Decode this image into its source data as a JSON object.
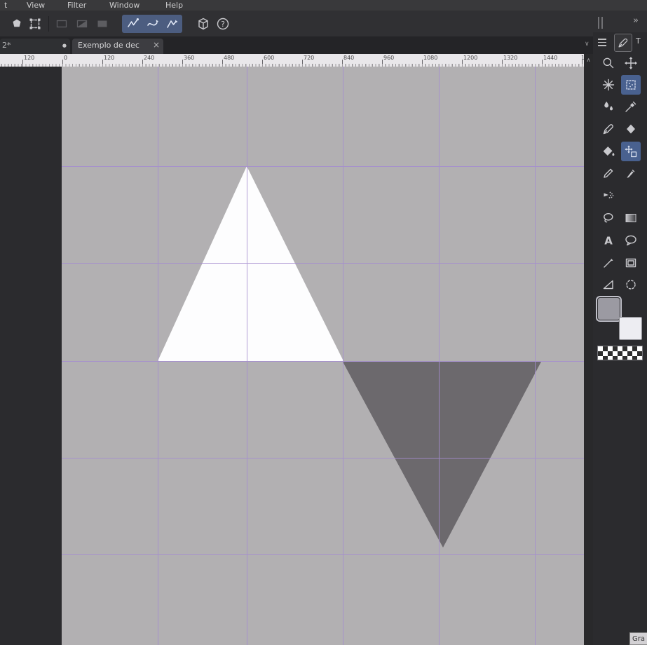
{
  "menu_bar": {
    "items": [
      "t",
      "View",
      "Filter",
      "Window",
      "Help"
    ]
  },
  "top_toolbar": {
    "tools": [
      "selection",
      "transform-frame",
      "marquee-rectangle",
      "marquee-shaded",
      "marquee-filled",
      "selection-polyline",
      "selection-curve",
      "selection-pen",
      "3d-cube",
      "help"
    ],
    "help_glyph": "?"
  },
  "window_chrome": {
    "collapse_glyph": "»",
    "scroll_up_glyph": "∧",
    "tab_list_glyph": "∨"
  },
  "tabs": {
    "partial": {
      "label": "2*",
      "modified_indicator": "●"
    },
    "active": {
      "label": "Exemplo de dec",
      "close_glyph": "×"
    }
  },
  "ruler": {
    "labels": [
      "120",
      "0",
      "120",
      "240",
      "360",
      "480",
      "600",
      "720",
      "840",
      "960",
      "1080",
      "1200",
      "1320",
      "1440",
      "1"
    ]
  },
  "canvas": {
    "background": "#b2b0b2",
    "pasteboard": "#2b2b2e",
    "grid_color": "#a58dd0",
    "triangle_up_fill": "#fdfdfe",
    "triangle_down_fill": "#6c696d"
  },
  "tool_palette": {
    "header_label": "T",
    "tools": [
      "zoom",
      "move",
      "operation",
      "auto-select",
      "blend",
      "eyedropper",
      "pen",
      "eraser",
      "fill",
      "move-layer",
      "pencil",
      "marker",
      "airbrush",
      "lasso",
      "gradient",
      "text",
      "balloon",
      "line",
      "frame",
      "correct-line",
      "select-circle"
    ],
    "text_glyph": "A",
    "colors": {
      "main": "#9b9aa2",
      "sub": "#ededf2"
    }
  },
  "bottom_right": {
    "label": "Gra"
  }
}
